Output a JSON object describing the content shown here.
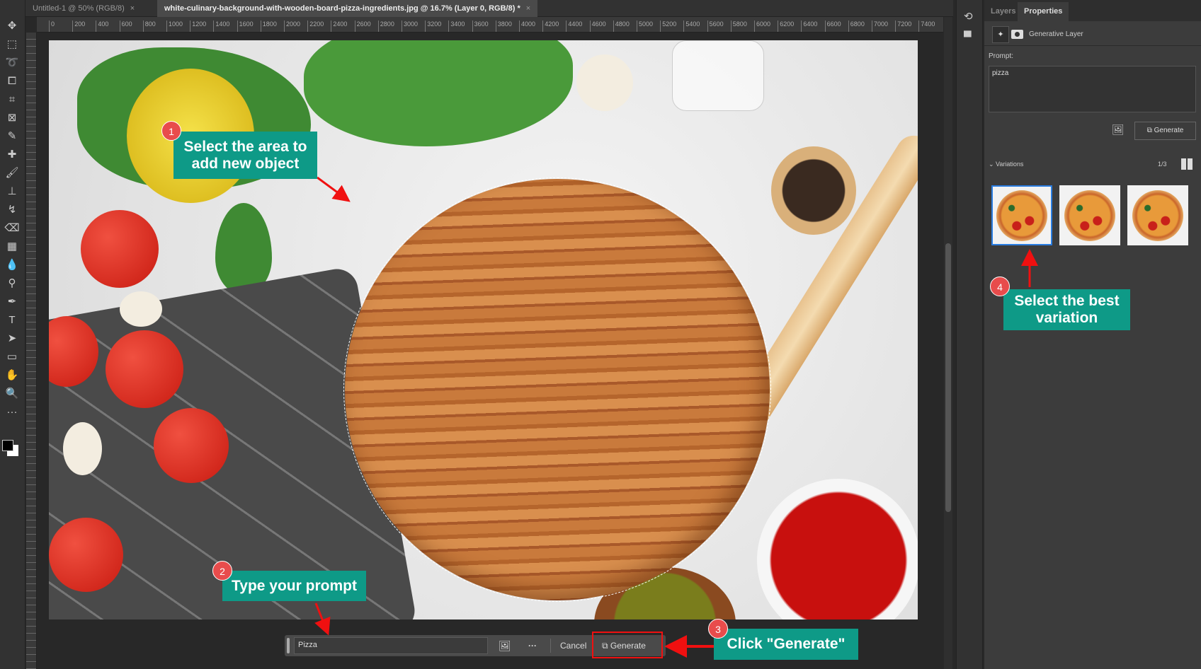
{
  "tabs": [
    {
      "label": "Untitled-1 @ 50% (RGB/8)",
      "close": "×"
    },
    {
      "label": "white-culinary-background-with-wooden-board-pizza-ingredients.jpg @ 16.7% (Layer 0, RGB/8) *",
      "close": "×"
    }
  ],
  "ruler_ticks": [
    "0",
    "200",
    "400",
    "600",
    "800",
    "1000",
    "1200",
    "1400",
    "1600",
    "1800",
    "2000",
    "2200",
    "2400",
    "2600",
    "2800",
    "3000",
    "3200",
    "3400",
    "3600",
    "3800",
    "4000",
    "4200",
    "4400",
    "4600",
    "4800",
    "5000",
    "5200",
    "5400",
    "5600",
    "5800",
    "6000",
    "6200",
    "6400",
    "6600",
    "6800",
    "7000",
    "7200",
    "7400"
  ],
  "tools": [
    "move-icon",
    "marquee-icon",
    "lasso-icon",
    "object-select-icon",
    "crop-icon",
    "frame-icon",
    "eyedropper-icon",
    "healing-icon",
    "brush-icon",
    "stamp-icon",
    "history-brush-icon",
    "eraser-icon",
    "gradient-icon",
    "blur-icon",
    "dodge-icon",
    "pen-icon",
    "type-icon",
    "path-select-icon",
    "rectangle-icon",
    "hand-icon",
    "zoom-icon",
    "more-icon"
  ],
  "callouts": [
    {
      "num": "1",
      "text": "Select the area to add new object"
    },
    {
      "num": "2",
      "text": "Type your prompt"
    },
    {
      "num": "3",
      "text": "Click \"Generate\""
    },
    {
      "num": "4",
      "text": "Select the best variation"
    }
  ],
  "genbar": {
    "prompt_value": "Pizza",
    "cancel": "Cancel",
    "generate": "Generate"
  },
  "panel": {
    "tabs": [
      "Layers",
      "Properties"
    ],
    "layer_name": "Generative Layer",
    "prompt_label": "Prompt:",
    "prompt_value": "pizza",
    "generate": "Generate",
    "variations_label": "Variations",
    "variation_count": "1/3",
    "selected_variation": 1
  },
  "colors": {
    "callout": "#0e9a87",
    "accent_red": "#f01010",
    "selection_blue": "#2a7de1"
  }
}
